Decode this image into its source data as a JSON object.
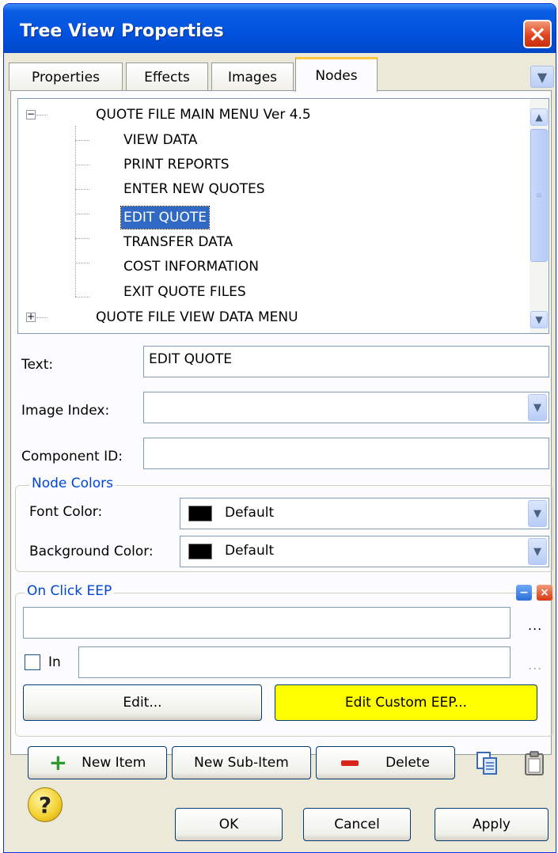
{
  "window": {
    "title": "Tree View Properties"
  },
  "tabs": [
    {
      "label": "Properties",
      "active": false
    },
    {
      "label": "Effects",
      "active": false
    },
    {
      "label": "Images",
      "active": false
    },
    {
      "label": "Nodes",
      "active": true
    }
  ],
  "tree": {
    "root1": "QUOTE FILE MAIN MENU Ver 4.5",
    "children": [
      "VIEW DATA",
      "PRINT REPORTS",
      "ENTER NEW QUOTES",
      "EDIT QUOTE",
      "TRANSFER DATA",
      "COST INFORMATION",
      "EXIT QUOTE FILES"
    ],
    "selected_index": 3,
    "root2": "QUOTE FILE VIEW DATA MENU"
  },
  "form": {
    "text_label": "Text:",
    "text_value": "EDIT QUOTE",
    "image_index_label": "Image Index:",
    "image_index_value": "",
    "component_id_label": "Component ID:",
    "component_id_value": ""
  },
  "node_colors": {
    "group_title": "Node Colors",
    "font_color_label": "Font Color:",
    "font_color_value": "Default",
    "background_color_label": "Background Color:",
    "background_color_value": "Default",
    "swatch_color": "#000000"
  },
  "on_click": {
    "group_title": "On Click EEP",
    "field_value": "",
    "ellipsis": "...",
    "in_label": "In",
    "in_value": "",
    "edit_button": "Edit...",
    "edit_custom_button": "Edit Custom EEP...",
    "edit_custom_color": "#ffff00"
  },
  "item_buttons": {
    "new_item": "New Item",
    "new_sub_item": "New Sub-Item",
    "delete": "Delete"
  },
  "footer": {
    "help_glyph": "?",
    "ok": "OK",
    "cancel": "Cancel",
    "apply": "Apply"
  }
}
